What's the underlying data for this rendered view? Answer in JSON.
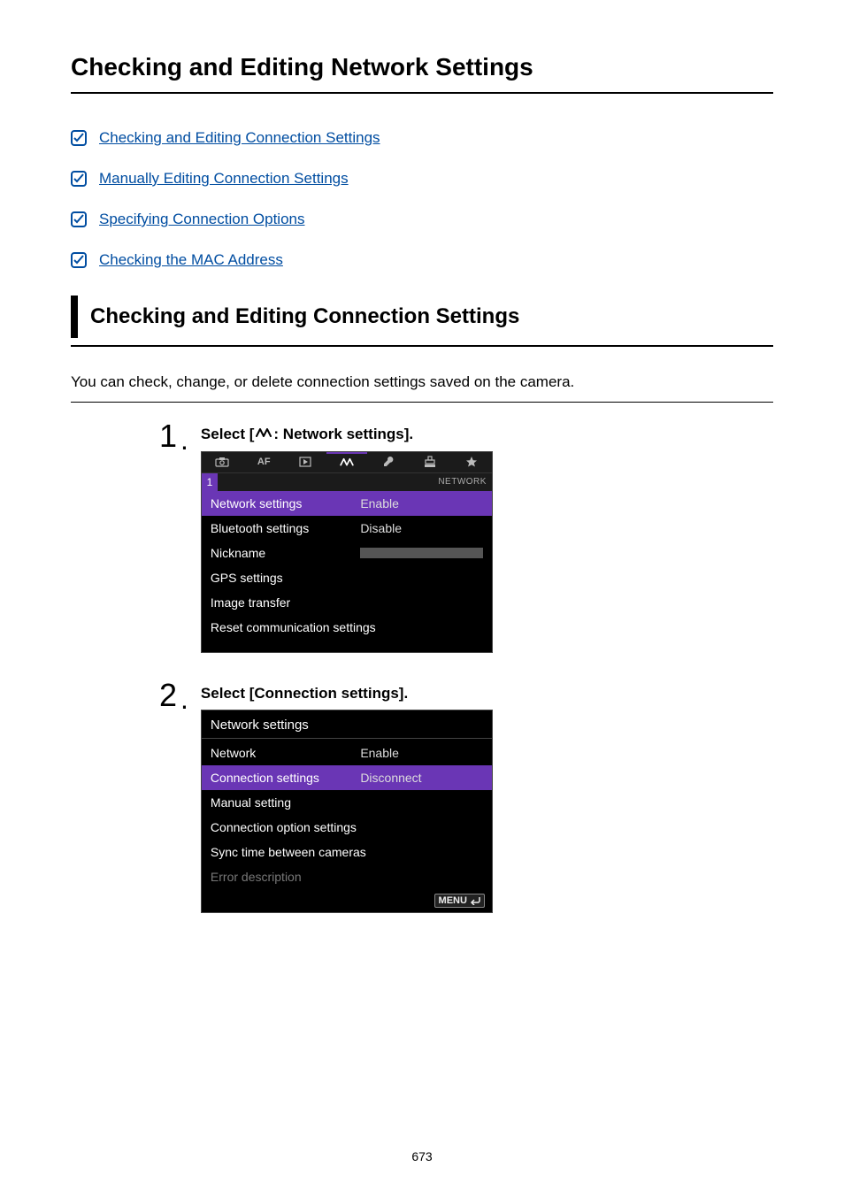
{
  "page_title": "Checking and Editing Network Settings",
  "toc": [
    {
      "label": "Checking and Editing Connection Settings"
    },
    {
      "label": "Manually Editing Connection Settings"
    },
    {
      "label": "Specifying Connection Options"
    },
    {
      "label": "Checking the MAC Address"
    }
  ],
  "section_heading": "Checking and Editing Connection Settings",
  "intro_text": "You can check, change, or delete connection settings saved on the camera.",
  "steps": [
    {
      "num": "1",
      "text_prefix": "Select [",
      "text_suffix": ": Network settings].",
      "screen": {
        "tab_right_label": "NETWORK",
        "sub_num": "1",
        "rows": [
          {
            "label": "Network settings",
            "value": "Enable",
            "selected": true
          },
          {
            "label": "Bluetooth settings",
            "value": "Disable"
          },
          {
            "label": "Nickname",
            "value_masked": true
          },
          {
            "label": "GPS settings",
            "value": ""
          },
          {
            "label": "Image transfer",
            "value": ""
          },
          {
            "label": "Reset communication settings",
            "value": ""
          }
        ]
      }
    },
    {
      "num": "2",
      "text": "Select [Connection settings].",
      "screen": {
        "title": "Network settings",
        "rows": [
          {
            "label": "Network",
            "value": "Enable"
          },
          {
            "label": "Connection settings",
            "value": "Disconnect",
            "selected": true
          },
          {
            "label": "Manual setting",
            "value": ""
          },
          {
            "label": "Connection option settings",
            "value": ""
          },
          {
            "label": "Sync time between cameras",
            "value": ""
          },
          {
            "label": "Error description",
            "value": "",
            "disabled": true
          }
        ],
        "footer_button": "MENU"
      }
    }
  ],
  "page_number": "673"
}
